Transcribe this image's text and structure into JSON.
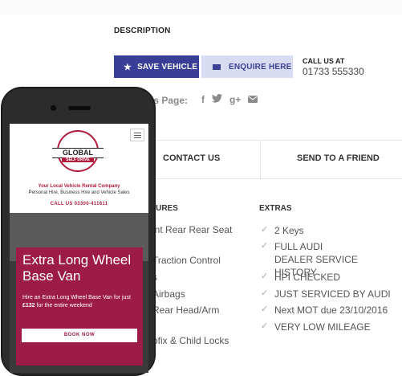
{
  "listing": {
    "description_heading": "DESCRIPTION",
    "save_button": "SAVE VEHICLE",
    "enquire_button": "ENQUIRE HERE",
    "call_label": "CALL US AT",
    "call_number": "01733 555330",
    "share_label": "is Page:",
    "share_icons": [
      "facebook-icon",
      "twitter-icon",
      "google-plus-icon",
      "email-icon"
    ],
    "contact_tab": "CONTACT US",
    "send_friend_tab": "SEND TO A FRIEND",
    "features_heading": "TURES",
    "features": [
      "int Rear Rear Seat",
      "Traction Control",
      "s",
      "Airbags",
      "Rear Head/Arm",
      "ofix & Child Locks"
    ],
    "extras_heading": "EXTRAS",
    "extras": [
      "2 Keys",
      "FULL AUDI DEALER SERVICE HISTORY",
      "HPI CHECKED",
      "JUST SERVICED BY AUDI",
      "Next MOT due 23/10/2016",
      "VERY LOW MILEAGE"
    ]
  },
  "phone": {
    "logo_text": "GLOBAL",
    "logo_sub": "SELF DRIVE",
    "tagline": "Your Local Vehicle Rental Company",
    "subtagline": "Personal Hire, Business Hire and Vehicle Sales",
    "call_line": "CALL US 03300-411611",
    "promo_title": "Extra Long Wheel Base Van",
    "promo_text_a": "Hire an Extra Long Wheel Base Van for just ",
    "promo_price": "£132",
    "promo_text_b": " for the entire weekend",
    "book_button": "BOOK NOW"
  },
  "colors": {
    "primary": "#393f96",
    "secondary": "#d8dcf3",
    "brand": "#9d1b47"
  }
}
